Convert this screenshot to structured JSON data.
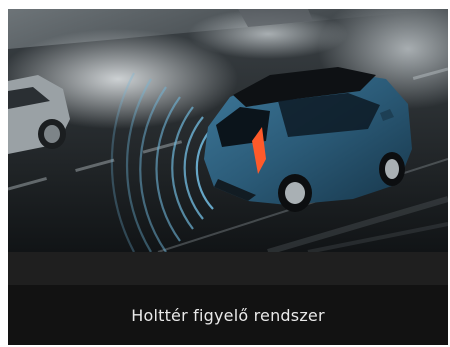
{
  "caption": {
    "text": "Holttér figyelő rendszer"
  },
  "image": {
    "icon": "car-blind-spot-illustration"
  },
  "colors": {
    "car_body": "#2b5b78",
    "sensor_waves": "#6fb6d9",
    "tail_light": "#ff5a2a",
    "caption_bg": "#121212"
  }
}
